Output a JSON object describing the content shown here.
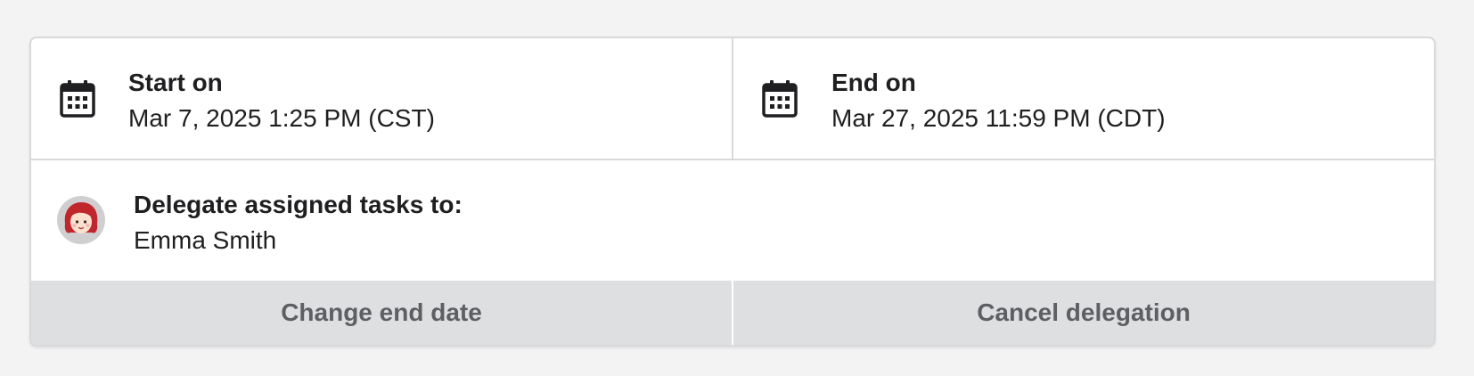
{
  "delegation": {
    "start": {
      "label": "Start on",
      "value": "Mar 7, 2025 1:25 PM (CST)",
      "icon": "calendar-icon"
    },
    "end": {
      "label": "End on",
      "value": "Mar 27, 2025 11:59 PM (CDT)",
      "icon": "calendar-icon"
    },
    "delegate": {
      "label": "Delegate assigned tasks to:",
      "name": "Emma Smith",
      "avatar": "avatar-icon"
    },
    "actions": {
      "change_end_date": "Change end date",
      "cancel_delegation": "Cancel delegation"
    }
  },
  "colors": {
    "border": "#d9d9dc",
    "button_bg": "#dedfe1",
    "button_text": "#5e5f63",
    "text": "#1f1f21",
    "avatar_hair": "#c0272d"
  }
}
